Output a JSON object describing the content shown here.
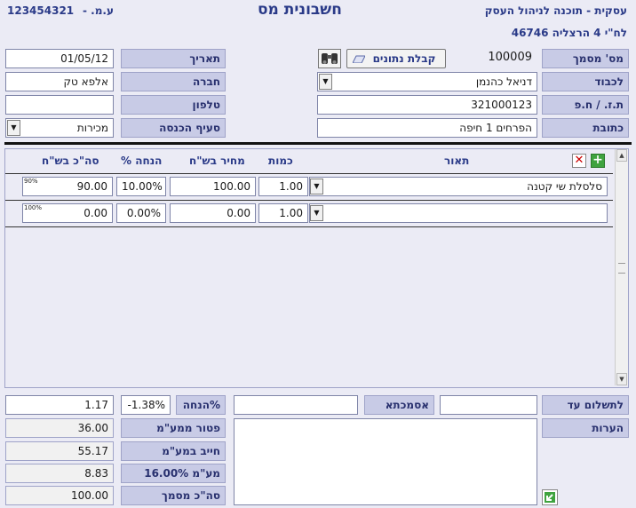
{
  "header": {
    "id_number": "123454321",
    "id_type": "ע.מ. -",
    "title": "חשבונית מס",
    "company_line": "עסקית - תוכנה לניהול העסק",
    "address": "לח\"י 4 הרצליה 46746"
  },
  "form": {
    "doc_number_label": "מס' מסמך",
    "doc_number_value": "100009",
    "receive_data_button": "קבלת נתונים",
    "date_label": "תאריך",
    "date_value": "01/05/12",
    "to_label": "לכבוד",
    "to_value": "דניאל כהנמן",
    "company_label": "חברה",
    "company_value": "אלפא טק",
    "id_label": "ת.ז. / ח.פ",
    "id_value": "321000123",
    "phone_label": "טלפון",
    "phone_value": "",
    "address_label": "כתובת",
    "address_value": "הפרחים 1 חיפה",
    "income_label": "סעיף הכנסה",
    "income_value": "מכירות"
  },
  "table": {
    "headers": {
      "description": "תאור",
      "quantity": "כמות",
      "price": "מחיר בש\"ח",
      "discount": "% הנחה",
      "total": "סה\"כ בש\"ח"
    },
    "rows": [
      {
        "description": "סלסלת שי קטנה",
        "quantity": "1.00",
        "price": "100.00",
        "discount": "10.00%",
        "total": "90.00",
        "pct": "90%"
      },
      {
        "description": "",
        "quantity": "1.00",
        "price": "0.00",
        "discount": "0.00%",
        "total": "0.00",
        "pct": "100%"
      }
    ]
  },
  "footer": {
    "pay_until_label": "לתשלום עד",
    "pay_until_value": "",
    "reference_label": "אסמכתא",
    "reference_value": "",
    "notes_label": "הערות",
    "notes_value": "",
    "discount_label": "%הנחה",
    "discount_pct": "-1.38%",
    "discount_amount": "1.17",
    "vat_exempt_label": "פטור ממע\"מ",
    "vat_exempt_value": "36.00",
    "vat_liable_label": "חייב במע\"מ",
    "vat_liable_value": "55.17",
    "vat_label": "מע\"מ 16.00%",
    "vat_value": "8.83",
    "total_label": "סה\"כ מסמך",
    "total_value": "100.00"
  },
  "icons": {
    "binoculars": "binoculars-icon",
    "add": "add-row-icon",
    "delete": "delete-row-icon",
    "exit": "exit-icon"
  }
}
